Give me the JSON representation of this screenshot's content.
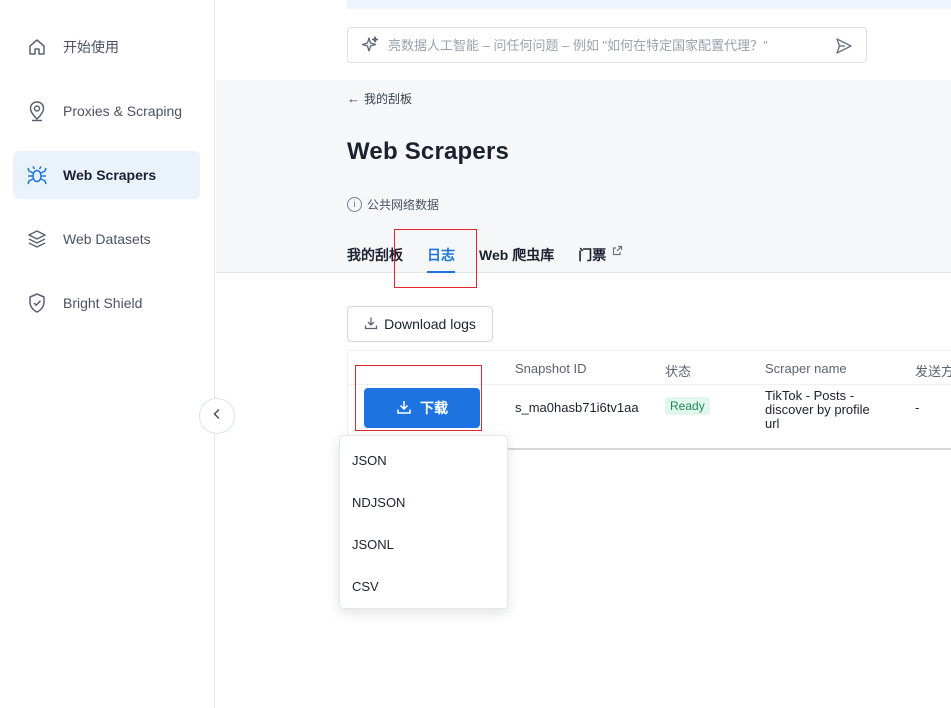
{
  "sidebar": {
    "items": [
      {
        "label": "开始使用",
        "icon": "home-icon"
      },
      {
        "label": "Proxies & Scraping",
        "icon": "location-pin-icon"
      },
      {
        "label": "Web Scrapers",
        "icon": "spider-icon",
        "active": true
      },
      {
        "label": "Web Datasets",
        "icon": "layers-icon"
      },
      {
        "label": "Bright Shield",
        "icon": "shield-check-icon"
      }
    ]
  },
  "ai_search": {
    "placeholder": "亮数据人工智能 – 问任何问题 – 例如 \"如何在特定国家配置代理？\""
  },
  "header": {
    "back_label": "我的刮板",
    "title": "Web Scrapers",
    "subtitle": "公共网络数据"
  },
  "tabs": [
    {
      "label": "我的刮板"
    },
    {
      "label": "日志",
      "active": true
    },
    {
      "label": "Web 爬虫库"
    },
    {
      "label": "门票",
      "external": true
    }
  ],
  "actions": {
    "download_logs": "Download logs",
    "download": "下载"
  },
  "table": {
    "headers": {
      "snapshot": "Snapshot ID",
      "status": "状态",
      "scraper": "Scraper name",
      "send": "发送方"
    },
    "row": {
      "snapshot": "s_ma0hasb71i6tv1aa",
      "status": "Ready",
      "scraper": "TikTok - Posts - discover by profile url",
      "send": "-"
    }
  },
  "dropdown": {
    "options": [
      "JSON",
      "NDJSON",
      "JSONL",
      "CSV"
    ]
  },
  "colors": {
    "accent": "#1d74e0",
    "highlight": "#e0282e",
    "ready_bg": "#e3f6ec",
    "ready_text": "#1f8a5a"
  }
}
